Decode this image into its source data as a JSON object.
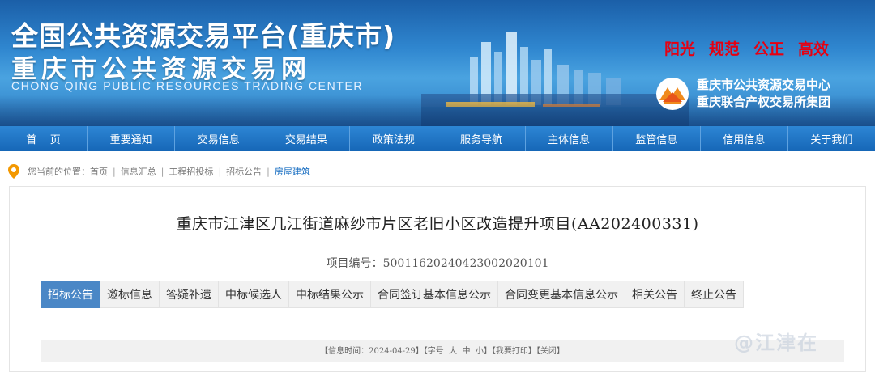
{
  "header": {
    "title_line1": "全国公共资源交易平台(重庆市)",
    "title_line2": "重庆市公共资源交易网",
    "title_en": "CHONG QING PUBLIC RESOURCES TRADING CENTER",
    "slogans": [
      "阳光",
      "规范",
      "公正",
      "高效"
    ],
    "org_name1": "重庆市公共资源交易中心",
    "org_name2": "重庆联合产权交易所集团"
  },
  "nav": [
    {
      "label": "首    页"
    },
    {
      "label": "重要通知"
    },
    {
      "label": "交易信息"
    },
    {
      "label": "交易结果"
    },
    {
      "label": "政策法规"
    },
    {
      "label": "服务导航"
    },
    {
      "label": "主体信息"
    },
    {
      "label": "监管信息"
    },
    {
      "label": "信用信息"
    },
    {
      "label": "关于我们"
    }
  ],
  "breadcrumb": {
    "prefix": "您当前的位置：",
    "items": [
      "首页",
      "信息汇总",
      "工程招投标",
      "招标公告",
      "房屋建筑"
    ]
  },
  "project": {
    "title": "重庆市江津区几江街道麻纱市片区老旧小区改造提升项目(AA202400331)",
    "code_label": "项目编号：",
    "code": "500116202404230020201​01"
  },
  "tabs": [
    {
      "label": "招标公告",
      "active": true
    },
    {
      "label": "邀标信息"
    },
    {
      "label": "答疑补遗"
    },
    {
      "label": "中标候选人"
    },
    {
      "label": "中标结果公示"
    },
    {
      "label": "合同签订基本信息公示"
    },
    {
      "label": "合同变更基本信息公示"
    },
    {
      "label": "相关公告"
    },
    {
      "label": "终止公告"
    }
  ],
  "info_bar": {
    "time": "【信息时间：2024-04-29】",
    "font_size": "【字号  大  中  小】",
    "print": "【我要打印】",
    "close": "【关闭】"
  },
  "watermark": "@江津在",
  "colors": {
    "slogan": "#e60012",
    "nav_bg": "#1e74c4",
    "active_tab": "#4a87c6",
    "pin": "#f39800"
  }
}
